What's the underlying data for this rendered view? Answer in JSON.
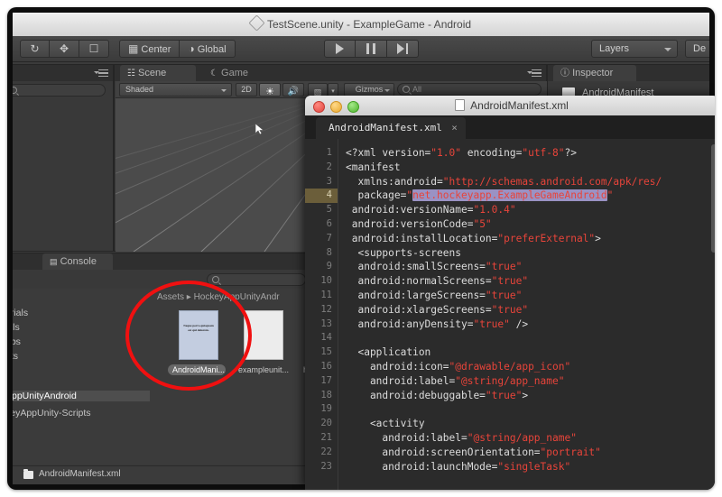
{
  "window": {
    "title": "TestScene.unity - ExampleGame - Android",
    "app_icon": "unity-cube-icon"
  },
  "toolbar": {
    "transform_tools": [
      "rotate-tool-icon",
      "scale-tool-icon",
      "rect-tool-icon"
    ],
    "pivot_mode": "Center",
    "pivot_rotation": "Global",
    "play": "play-icon",
    "pause": "pause-icon",
    "step": "step-icon",
    "layers": "Layers",
    "layout": "De"
  },
  "hierarchy": {
    "menu_icon": "panel-menu-icon",
    "search_placeholder": ""
  },
  "scene_panel": {
    "tabs": [
      {
        "label": "Scene",
        "icon": "scene-grid-icon",
        "active": true
      },
      {
        "label": "Game",
        "icon": "game-moon-icon",
        "active": false
      }
    ],
    "draw_mode": "Shaded",
    "two_d": "2D",
    "lighting_icon": "sun-icon",
    "audio_icon": "speaker-icon",
    "fx_icon": "image-icon",
    "gizmos": "Gizmos",
    "search_placeholder": "All",
    "menu_icon": "panel-menu-icon"
  },
  "inspector": {
    "tab_label": "Inspector",
    "tab_icon": "inspector-info-icon",
    "selected_asset": "AndroidManifest"
  },
  "console": {
    "tab_label": "Console",
    "tab_icon": "console-icon"
  },
  "project": {
    "search_placeholder": "",
    "breadcrumb": "Assets ▸ HockeyAppUnityAndr",
    "tree_items": [
      {
        "label": "erials",
        "selected": false
      },
      {
        "label": "lels",
        "selected": false
      },
      {
        "label": "abs",
        "selected": false
      },
      {
        "label": "pts",
        "selected": false
      },
      {
        "label": "AppUnityAndroid",
        "selected": true
      },
      {
        "label": "keyAppUnity-Scripts",
        "selected": false
      }
    ],
    "assets": [
      {
        "label": "AndroidMani...",
        "selected": true,
        "thumb": "xml-document-thumb",
        "preview_text": "Neque porro quisquam est qui dolorem."
      },
      {
        "label": "exampleunit...",
        "selected": false,
        "thumb": "blank-document-thumb",
        "preview_text": ""
      },
      {
        "label": "ho",
        "selected": false,
        "thumb": "blank-document-thumb",
        "preview_text": ""
      }
    ]
  },
  "statusbar": {
    "file_icon": "file-icon",
    "text": "AndroidManifest.xml"
  },
  "editor": {
    "window_title": "AndroidManifest.xml",
    "title_icon": "document-icon",
    "traffic_lights": [
      "close-red",
      "minimize-yellow",
      "zoom-green"
    ],
    "tab": {
      "label": "AndroidManifest.xml",
      "close": "×"
    },
    "highlight_line": 4,
    "lines": [
      {
        "n": 1,
        "html": "&lt;?xml version=<span class=\"s\">\"1.0\"</span> encoding=<span class=\"s\">\"utf-8\"</span>?&gt;"
      },
      {
        "n": 2,
        "html": "&lt;manifest"
      },
      {
        "n": 3,
        "html": "  xmlns:android=<span class=\"s\">\"http://schemas.android.com/apk/res/</span>"
      },
      {
        "n": 4,
        "html": "  package=<span class=\"s\">\"</span><span class=\"hlsel\">net.hockeyapp.ExampleGameAndroid</span><span class=\"s\">\"</span>"
      },
      {
        "n": 5,
        "html": " android:versionName=<span class=\"s\">\"1.0.4\"</span>"
      },
      {
        "n": 6,
        "html": " android:versionCode=<span class=\"s\">\"5\"</span>"
      },
      {
        "n": 7,
        "html": " android:installLocation=<span class=\"s\">\"preferExternal\"</span>&gt;"
      },
      {
        "n": 8,
        "html": "  &lt;supports-screens"
      },
      {
        "n": 9,
        "html": "  android:smallScreens=<span class=\"s\">\"true\"</span>"
      },
      {
        "n": 10,
        "html": "  android:normalScreens=<span class=\"s\">\"true\"</span>"
      },
      {
        "n": 11,
        "html": "  android:largeScreens=<span class=\"s\">\"true\"</span>"
      },
      {
        "n": 12,
        "html": "  android:xlargeScreens=<span class=\"s\">\"true\"</span>"
      },
      {
        "n": 13,
        "html": "  android:anyDensity=<span class=\"s\">\"true\"</span> /&gt;"
      },
      {
        "n": 14,
        "html": ""
      },
      {
        "n": 15,
        "html": "  &lt;application"
      },
      {
        "n": 16,
        "html": "    android:icon=<span class=\"s\">\"@drawable/app_icon\"</span>"
      },
      {
        "n": 17,
        "html": "    android:label=<span class=\"s\">\"@string/app_name\"</span>"
      },
      {
        "n": 18,
        "html": "    android:debuggable=<span class=\"s\">\"true\"</span>&gt;"
      },
      {
        "n": 19,
        "html": ""
      },
      {
        "n": 20,
        "html": "    &lt;activity"
      },
      {
        "n": 21,
        "html": "      android:label=<span class=\"s\">\"@string/app_name\"</span>"
      },
      {
        "n": 22,
        "html": "      android:screenOrientation=<span class=\"s\">\"portrait\"</span>"
      },
      {
        "n": 23,
        "html": "      android:launchMode=<span class=\"s\">\"singleTask\"</span>"
      }
    ]
  },
  "annotation": {
    "shape": "red-ellipse-highlight",
    "color": "#f01010"
  }
}
